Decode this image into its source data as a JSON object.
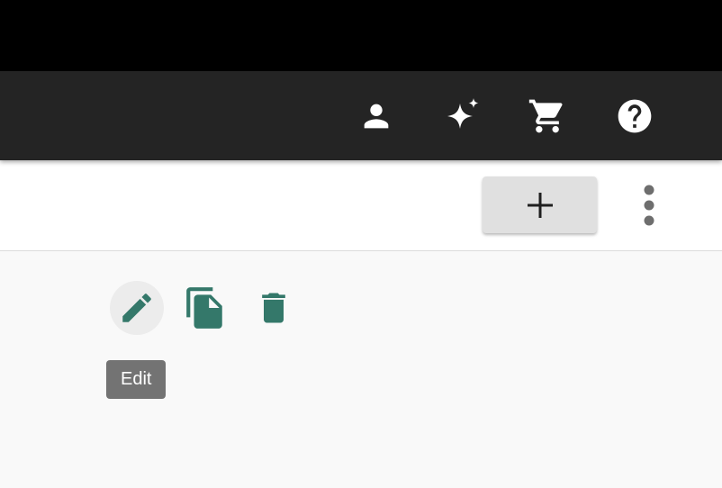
{
  "appbar": {
    "icons": [
      {
        "icon": "account-icon"
      },
      {
        "icon": "sparkle-icon"
      },
      {
        "icon": "cart-icon"
      },
      {
        "icon": "help-icon"
      }
    ],
    "icon_color": "#ffffff",
    "background": "#242424"
  },
  "toolbar": {
    "add_button_icon": "plus-icon",
    "more_button_icon": "more-vertical-icon"
  },
  "actions": {
    "icon_color": "#34786a",
    "items": [
      {
        "icon": "pencil-icon",
        "state": "hover"
      },
      {
        "icon": "copy-document-icon"
      },
      {
        "icon": "trash-icon"
      }
    ]
  },
  "tooltip": {
    "text": "Edit"
  }
}
